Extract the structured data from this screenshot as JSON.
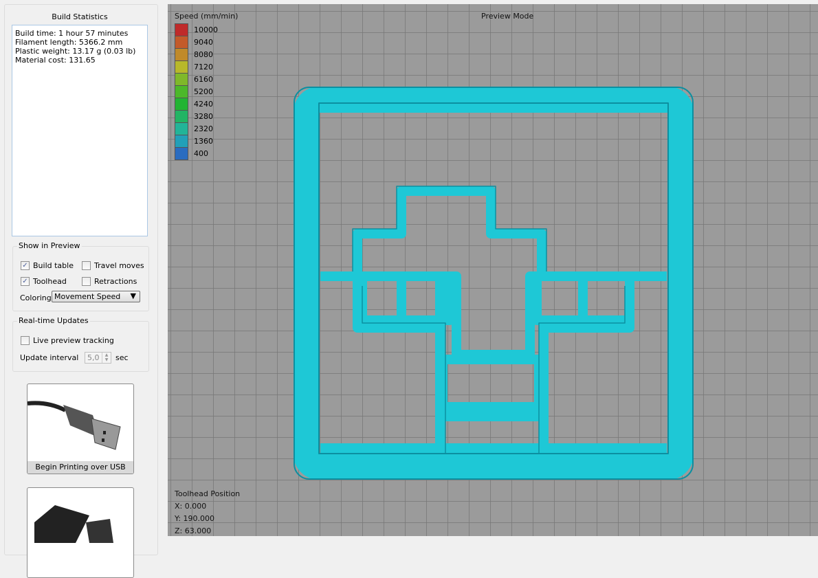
{
  "sidebar": {
    "build_statistics_title": "Build Statistics",
    "stats": [
      "Build time: 1 hour 57 minutes",
      "Filament length: 5366.2 mm",
      "Plastic weight: 13.17 g (0.03 lb)",
      "Material cost: 131.65"
    ],
    "show_in_preview": {
      "title": "Show in Preview",
      "build_table": "Build table",
      "build_table_checked": true,
      "travel_moves": "Travel moves",
      "travel_moves_checked": false,
      "toolhead": "Toolhead",
      "toolhead_checked": true,
      "retractions": "Retractions",
      "retractions_checked": false,
      "coloring_label": "Coloring",
      "coloring_value": "Movement Speed"
    },
    "realtime": {
      "title": "Real-time Updates",
      "live_tracking": "Live preview tracking",
      "live_tracking_checked": false,
      "interval_label": "Update interval",
      "interval_value": "5,0",
      "interval_unit": "sec"
    },
    "usb_button": "Begin Printing over USB"
  },
  "viewport": {
    "mode": "Preview Mode",
    "legend_title": "Speed (mm/min)",
    "legend": [
      {
        "v": "10000",
        "c": "#bf2a2a"
      },
      {
        "v": "9040",
        "c": "#c35a2a"
      },
      {
        "v": "8080",
        "c": "#c08a2a"
      },
      {
        "v": "7120",
        "c": "#b8b82a"
      },
      {
        "v": "6160",
        "c": "#7fb82a"
      },
      {
        "v": "5200",
        "c": "#4cb82a"
      },
      {
        "v": "4240",
        "c": "#22b432"
      },
      {
        "v": "3280",
        "c": "#22b464"
      },
      {
        "v": "2320",
        "c": "#22b498"
      },
      {
        "v": "1360",
        "c": "#22a0b8"
      },
      {
        "v": "400",
        "c": "#2a6cc0"
      }
    ],
    "toolhead_title": "Toolhead Position",
    "x": "X: 0.000",
    "y": "Y: 190.000",
    "z": "Z: 63.000",
    "model_color": "#1ec8d6"
  }
}
